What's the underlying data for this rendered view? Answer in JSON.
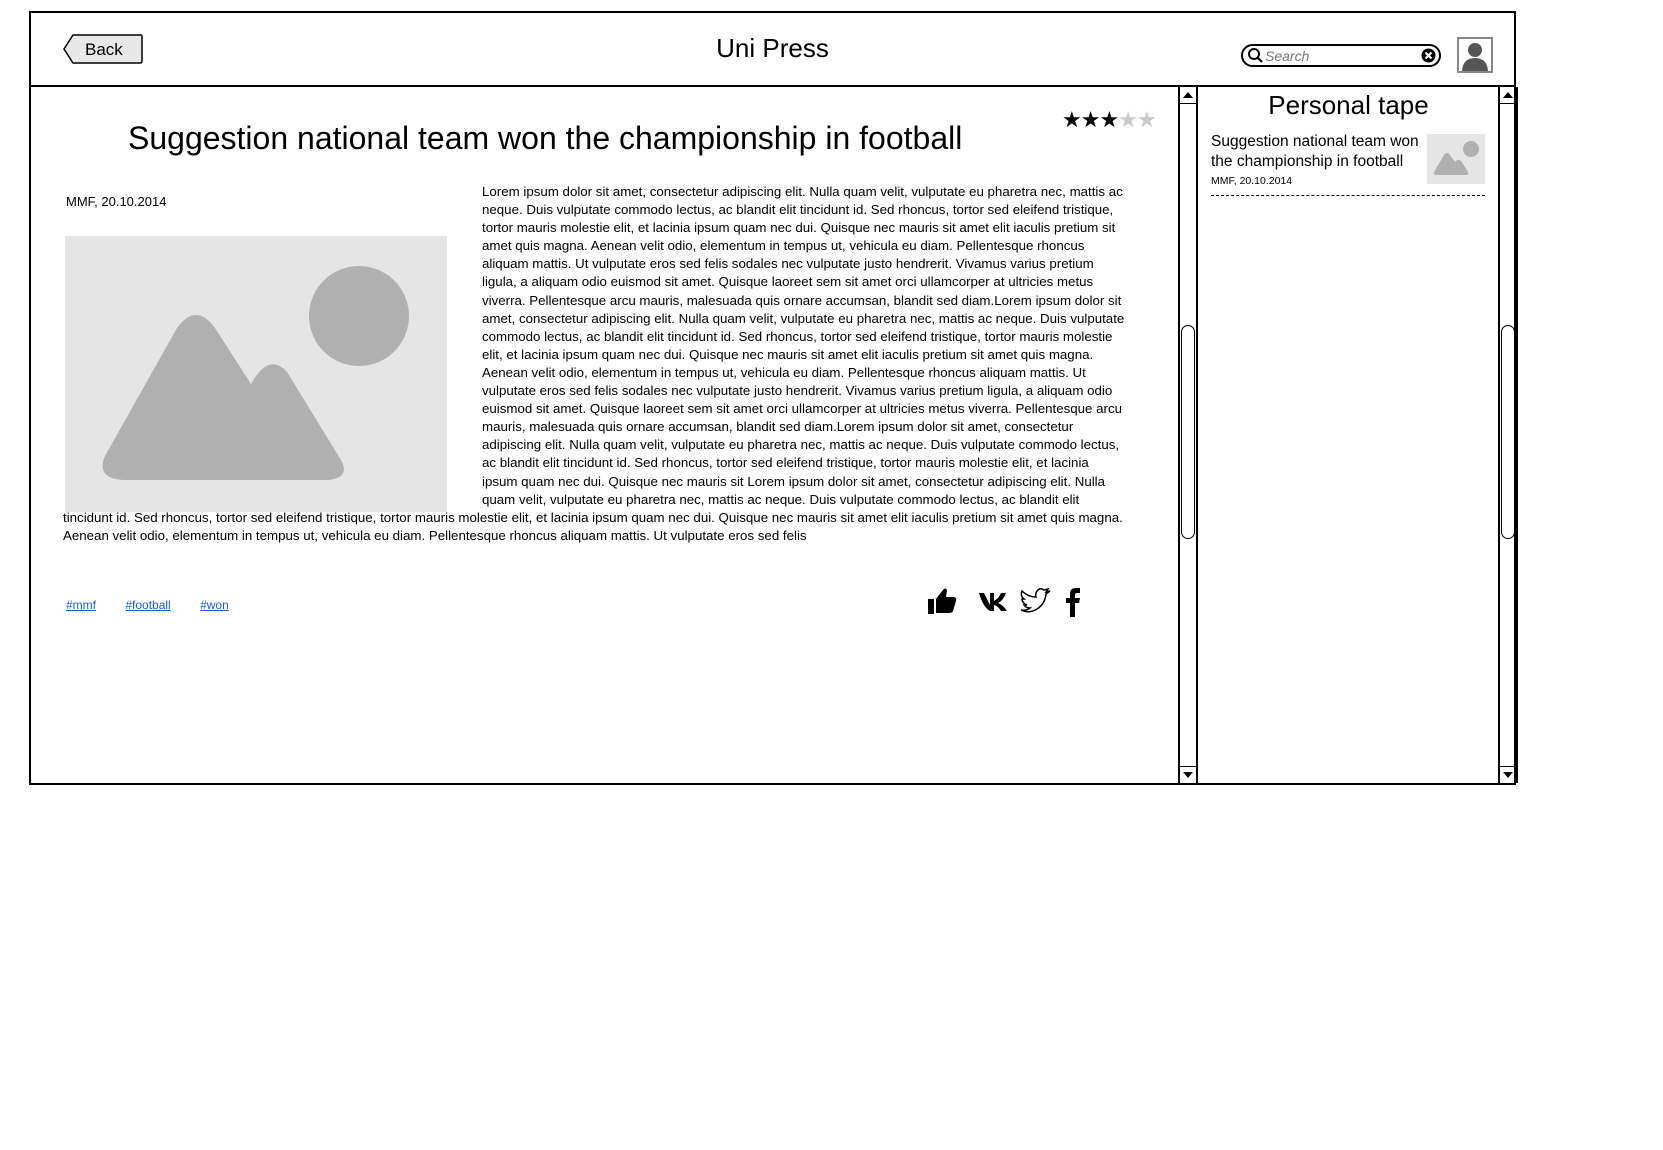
{
  "header": {
    "back_label": "Back",
    "app_title": "Uni Press",
    "search_placeholder": "Search"
  },
  "article": {
    "title": "Suggestion national team won the championship in football",
    "rating": {
      "value": 3,
      "max": 5
    },
    "meta": "MMF, 20.10.2014",
    "body": "Lorem ipsum dolor sit amet, consectetur adipiscing elit. Nulla quam velit, vulputate eu pharetra nec, mattis ac neque. Duis vulputate commodo lectus, ac blandit elit tincidunt id. Sed rhoncus, tortor sed eleifend tristique, tortor mauris molestie elit, et lacinia ipsum quam nec dui. Quisque nec mauris sit amet elit iaculis pretium sit amet quis magna. Aenean velit odio, elementum in tempus ut, vehicula eu diam. Pellentesque rhoncus aliquam mattis. Ut vulputate eros sed felis sodales nec vulputate justo hendrerit. Vivamus varius pretium ligula, a aliquam odio euismod sit amet. Quisque laoreet sem sit amet orci ullamcorper at ultricies metus viverra. Pellentesque arcu mauris, malesuada quis ornare accumsan, blandit sed diam.Lorem ipsum dolor sit amet, consectetur adipiscing elit. Nulla quam velit, vulputate eu pharetra nec, mattis ac neque. Duis vulputate commodo lectus, ac blandit elit tincidunt id. Sed rhoncus, tortor sed eleifend tristique, tortor mauris molestie elit, et lacinia ipsum quam nec dui. Quisque nec mauris sit amet elit iaculis pretium sit amet quis magna. Aenean velit odio, elementum in tempus ut, vehicula eu diam. Pellentesque rhoncus aliquam mattis. Ut vulputate eros sed felis sodales nec vulputate justo hendrerit. Vivamus varius pretium ligula, a aliquam odio euismod sit amet. Quisque laoreet sem sit amet orci ullamcorper at ultricies metus viverra. Pellentesque arcu mauris, malesuada quis ornare accumsan, blandit sed diam.Lorem ipsum dolor sit amet, consectetur adipiscing elit. Nulla quam velit, vulputate eu pharetra nec, mattis ac neque. Duis vulputate commodo lectus, ac blandit elit tincidunt id. Sed rhoncus, tortor sed eleifend tristique, tortor mauris molestie elit, et lacinia ipsum quam nec dui. Quisque nec mauris sit Lorem ipsum dolor sit amet, consectetur adipiscing elit. Nulla quam velit, vulputate eu pharetra nec, mattis ac neque. Duis vulputate commodo lectus, ac blandit elit tincidunt id. Sed rhoncus, tortor sed eleifend tristique, tortor mauris molestie elit, et lacinia ipsum quam nec dui. Quisque nec mauris sit amet elit iaculis pretium sit amet quis magna. Aenean velit odio, elementum in tempus ut, vehicula eu diam. Pellentesque rhoncus aliquam mattis. Ut vulputate eros sed felis",
    "tags": [
      "#mmf",
      "#football",
      "#won"
    ],
    "social": [
      "like-icon",
      "vk-icon",
      "twitter-icon",
      "facebook-icon"
    ]
  },
  "sidebar": {
    "title": "Personal tape",
    "items": [
      {
        "title": "Suggestion national team won the championship in football",
        "meta": "MMF, 20.10.2014"
      }
    ]
  },
  "colors": {
    "border": "#000000",
    "placeholder_bg": "#e5e5e5",
    "placeholder_fg": "#b0b0b0",
    "link": "#1a5fd6",
    "star_off": "#c9c9c9"
  }
}
